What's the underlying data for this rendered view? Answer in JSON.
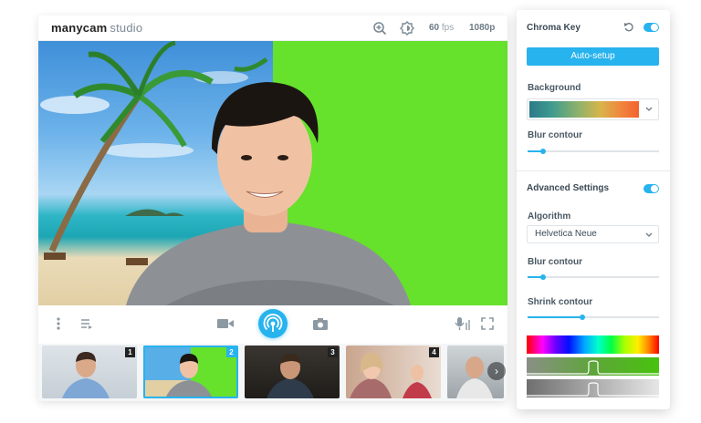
{
  "app": {
    "brand": "manycam",
    "product": "studio",
    "fps_value": "60",
    "fps_unit": "fps",
    "resolution": "1080p"
  },
  "icons": {
    "zoom": "zoom-in-icon",
    "brightness": "brightness-icon",
    "menu": "more-vertical-icon",
    "playlist": "playlist-icon",
    "video": "video-camera-icon",
    "broadcast": "broadcast-icon",
    "snapshot": "camera-icon",
    "mic": "microphone-icon",
    "fullscreen": "fullscreen-icon",
    "reset": "reset-icon"
  },
  "thumbnails": [
    "1",
    "2",
    "3",
    "4"
  ],
  "chroma_panel": {
    "title": "Chroma Key",
    "toggle_on": true,
    "auto_setup": "Auto-setup",
    "background_label": "Background",
    "blur_contour_label": "Blur contour",
    "blur_contour_value": 0.12,
    "advanced_title": "Advanced Settings",
    "advanced_toggle_on": true,
    "algorithm_label": "Algorithm",
    "algorithm_value": "Helvetica Neue",
    "blur_contour2_label": "Blur contour",
    "blur_contour2_value": 0.12,
    "shrink_contour_label": "Shrink contour",
    "shrink_contour_value": 0.42
  },
  "colors": {
    "accent": "#27b3ee",
    "green_screen": "#66e12c"
  }
}
